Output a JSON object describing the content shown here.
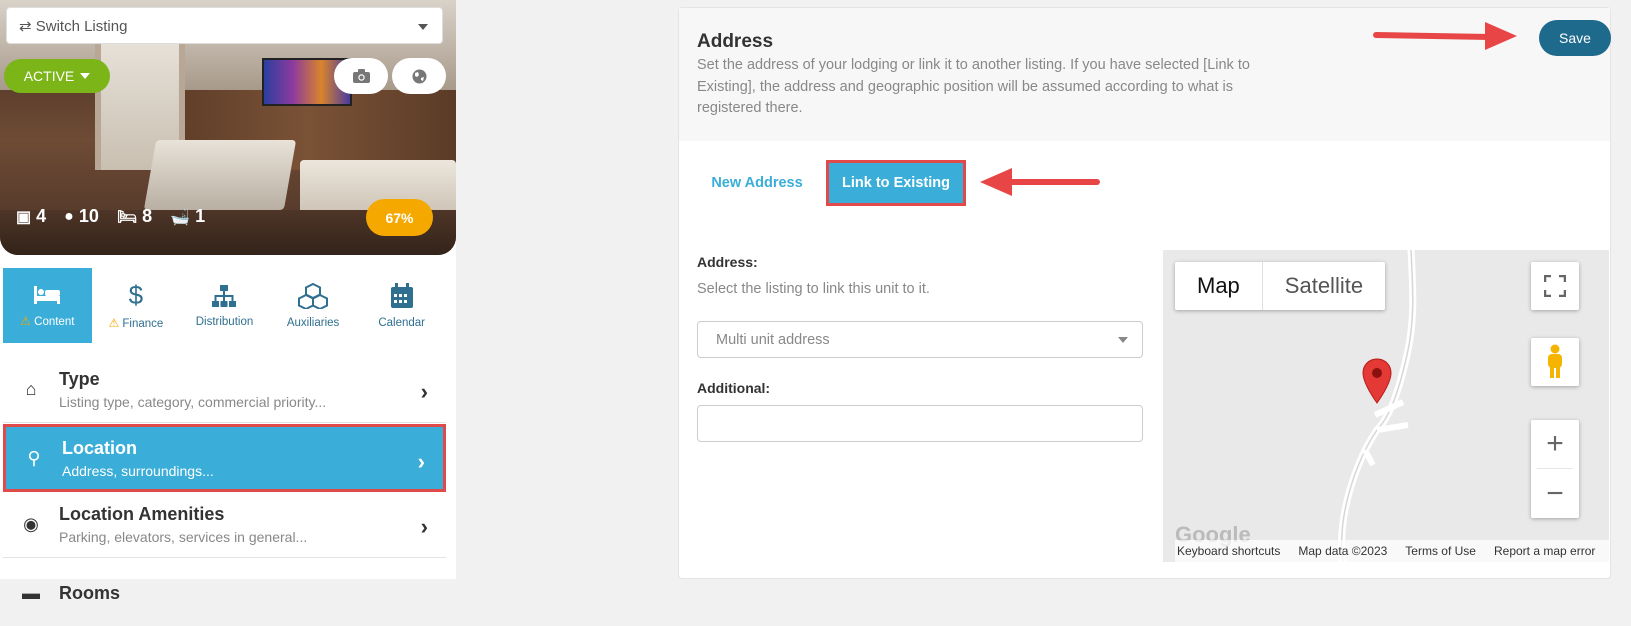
{
  "listing": {
    "switch_label": "⇄ Switch Listing",
    "status": "ACTIVE",
    "stats": {
      "units": "4",
      "guests": "10",
      "beds": "8",
      "baths": "1"
    },
    "completion": "67%"
  },
  "tabs": [
    {
      "label": "Content",
      "icon": "bed-icon",
      "warning": true
    },
    {
      "label": "Finance",
      "icon": "dollar-icon",
      "warning": true
    },
    {
      "label": "Distribution",
      "icon": "sitemap-icon",
      "warning": false
    },
    {
      "label": "Auxiliaries",
      "icon": "cubes-icon",
      "warning": false
    },
    {
      "label": "Calendar",
      "icon": "calendar-icon",
      "warning": false
    }
  ],
  "menu": [
    {
      "title": "Type",
      "subtitle": "Listing type, category, commercial priority...",
      "icon": "home-icon"
    },
    {
      "title": "Location",
      "subtitle": "Address, surroundings...",
      "icon": "map-marker-icon"
    },
    {
      "title": "Location Amenities",
      "subtitle": "Parking, elevators, services in general...",
      "icon": "target-icon"
    },
    {
      "title": "Rooms",
      "subtitle": "",
      "icon": "bed-icon"
    }
  ],
  "address": {
    "title": "Address",
    "description": "Set the address of your lodging or link it to another listing. If you have selected [Link to Existing], the address and geographic position will be assumed according to what is registered there.",
    "save_label": "Save",
    "subtab_new": "New Address",
    "subtab_link": "Link to Existing",
    "address_label": "Address:",
    "address_hint": "Select the listing to link this unit to it.",
    "address_placeholder": "Multi unit address",
    "additional_label": "Additional:",
    "additional_value": ""
  },
  "map": {
    "type_map": "Map",
    "type_satellite": "Satellite",
    "footer": {
      "shortcuts": "Keyboard shortcuts",
      "data": "Map data ©2023",
      "terms": "Terms of Use",
      "report": "Report a map error"
    },
    "logo": "Google"
  },
  "colors": {
    "accent": "#3aaed8",
    "save": "#1e6a8d",
    "active": "#7cb518",
    "progress": "#f5a800",
    "annotation": "#e84646"
  }
}
